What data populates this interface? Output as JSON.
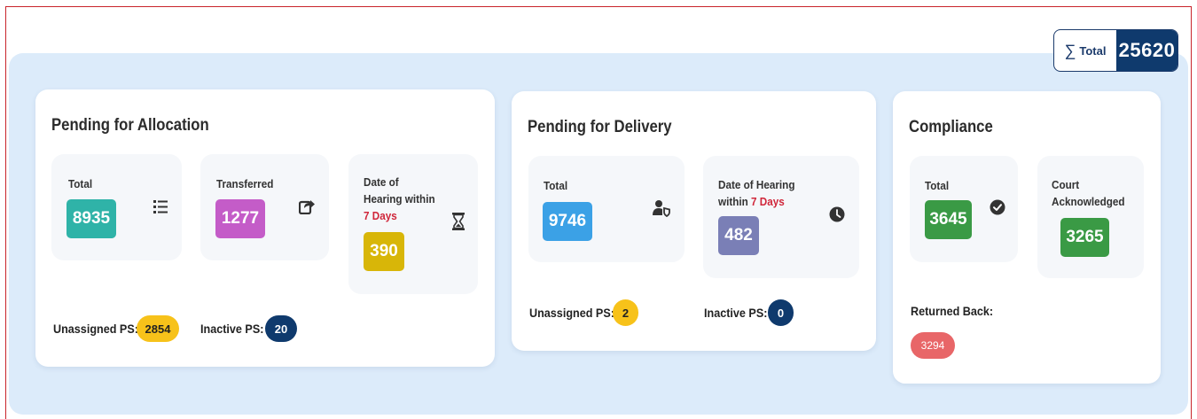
{
  "total_chip": {
    "label": "Total",
    "value": "25620"
  },
  "allocation": {
    "title": "Pending for Allocation",
    "total": {
      "label": "Total",
      "value": "8935"
    },
    "transferred": {
      "label": "Transferred",
      "value": "1277"
    },
    "hearing": {
      "label_line1": "Date of",
      "label_line2": "Hearing within",
      "label_days": "7 Days",
      "value": "390"
    },
    "unassigned": {
      "label": "Unassigned PS:",
      "value": "2854"
    },
    "inactive": {
      "label": "Inactive PS:",
      "value": "20"
    }
  },
  "delivery": {
    "title": "Pending for Delivery",
    "total": {
      "label": "Total",
      "value": "9746"
    },
    "hearing": {
      "label_line1": "Date of Hearing",
      "label_prefix": "within",
      "label_days": "7 Days",
      "value": "482"
    },
    "unassigned": {
      "label": "Unassigned PS:",
      "value": "2"
    },
    "inactive": {
      "label": "Inactive PS:",
      "value": "0"
    }
  },
  "compliance": {
    "title": "Compliance",
    "total": {
      "label": "Total",
      "value": "3645"
    },
    "court": {
      "label_line1": "Court",
      "label_line2": "Acknowledged",
      "value": "3265"
    },
    "returned": {
      "label": "Returned Back:",
      "value": "3294"
    }
  },
  "colors": {
    "teal": "#2fb3a8",
    "magenta": "#c45cc8",
    "mustard": "#d8b608",
    "blue": "#3ba1e6",
    "slate": "#7a7fb6",
    "green": "#3a9a45",
    "red_pill": "#e86668",
    "yellow_pill": "#f7c21a",
    "navy": "#0f3a6d"
  },
  "icons": [
    "sigma-icon",
    "list-icon",
    "share-icon",
    "hourglass-icon",
    "user-shield-icon",
    "clock-icon",
    "check-circle-icon"
  ]
}
